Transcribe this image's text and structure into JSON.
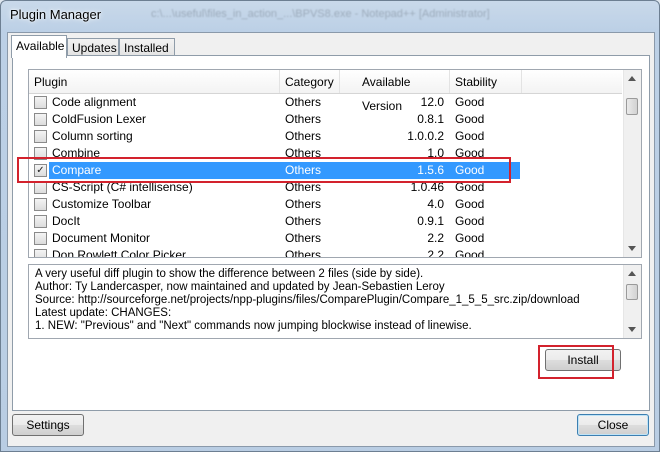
{
  "window": {
    "title": "Plugin Manager",
    "background_title": "c:\\...\\useful\\files_in_action_...\\BPVS8.exe - Notepad++ [Administrator]"
  },
  "tabs": [
    {
      "label": "Available",
      "active": true
    },
    {
      "label": "Updates",
      "active": false
    },
    {
      "label": "Installed",
      "active": false
    }
  ],
  "list": {
    "columns": [
      "Plugin",
      "Category",
      "Available Version",
      "Stability"
    ],
    "rows": [
      {
        "name": "Code alignment",
        "category": "Others",
        "version": "12.0",
        "stability": "Good",
        "checked": false,
        "selected": false
      },
      {
        "name": "ColdFusion Lexer",
        "category": "Others",
        "version": "0.8.1",
        "stability": "Good",
        "checked": false,
        "selected": false
      },
      {
        "name": "Column sorting",
        "category": "Others",
        "version": "1.0.0.2",
        "stability": "Good",
        "checked": false,
        "selected": false
      },
      {
        "name": "Combine",
        "category": "Others",
        "version": "1.0",
        "stability": "Good",
        "checked": false,
        "selected": false
      },
      {
        "name": "Compare",
        "category": "Others",
        "version": "1.5.6",
        "stability": "Good",
        "checked": true,
        "selected": true
      },
      {
        "name": "CS-Script (C# intellisense)",
        "category": "Others",
        "version": "1.0.46",
        "stability": "Good",
        "checked": false,
        "selected": false
      },
      {
        "name": "Customize Toolbar",
        "category": "Others",
        "version": "4.0",
        "stability": "Good",
        "checked": false,
        "selected": false
      },
      {
        "name": "DocIt",
        "category": "Others",
        "version": "0.9.1",
        "stability": "Good",
        "checked": false,
        "selected": false
      },
      {
        "name": "Document Monitor",
        "category": "Others",
        "version": "2.2",
        "stability": "Good",
        "checked": false,
        "selected": false
      },
      {
        "name": "Don Rowlett Color Picker",
        "category": "Others",
        "version": "2.2",
        "stability": "Good",
        "checked": false,
        "selected": false
      }
    ],
    "check_glyph": "✓"
  },
  "description": {
    "lines": [
      "A very useful diff plugin to show the difference between 2 files (side by side).",
      "Author: Ty Landercasper, now maintained and updated by Jean-Sebastien Leroy",
      "Source: http://sourceforge.net/projects/npp-plugins/files/ComparePlugin/Compare_1_5_5_src.zip/download",
      "Latest update: CHANGES:",
      "1. NEW: \"Previous\" and \"Next\" commands now jumping blockwise instead of linewise."
    ]
  },
  "buttons": {
    "install": "Install",
    "settings": "Settings",
    "close": "Close"
  },
  "colors": {
    "selection": "#3399ff",
    "highlight_box": "#d3222d"
  }
}
